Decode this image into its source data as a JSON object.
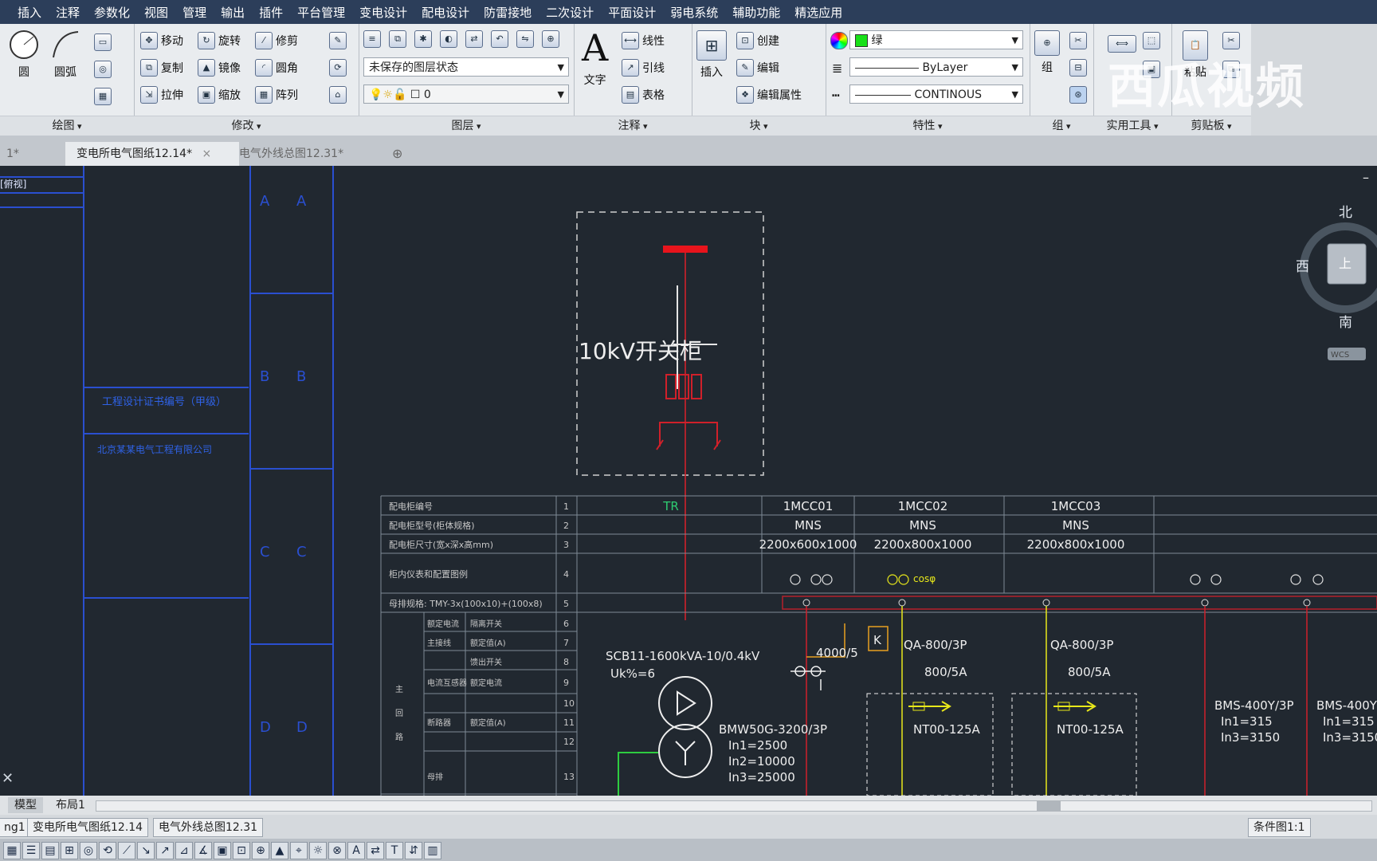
{
  "menu": [
    "插入",
    "注释",
    "参数化",
    "视图",
    "管理",
    "输出",
    "插件",
    "平台管理",
    "变电设计",
    "配电设计",
    "防雷接地",
    "二次设计",
    "平面设计",
    "弱电系统",
    "辅助功能",
    "精选应用"
  ],
  "ribbon": {
    "draw": {
      "title": "绘图",
      "circle": "圆",
      "arc": "圆弧"
    },
    "modify": {
      "title": "修改",
      "move": "移动",
      "rotate": "旋转",
      "trim": "修剪",
      "copy": "复制",
      "mirror": "镜像",
      "fillet": "圆角",
      "stretch": "拉伸",
      "scale": "缩放",
      "array": "阵列"
    },
    "layer": {
      "title": "图层",
      "state": "未保存的图层状态",
      "current": "0"
    },
    "annotation": {
      "title": "注释",
      "text": "文字",
      "linear": "线性",
      "leader": "引线",
      "table": "表格"
    },
    "block": {
      "title": "块",
      "insert": "插入",
      "create": "创建",
      "edit": "编辑",
      "edit_attr": "编辑属性"
    },
    "properties": {
      "title": "特性",
      "color": "绿",
      "lineweight": "ByLayer",
      "linetype": "CONTINOUS"
    },
    "group": {
      "title": "组",
      "label": "组"
    },
    "utilities": {
      "title": "实用工具"
    },
    "clipboard": {
      "title": "剪贴板",
      "paste": "粘贴"
    },
    "watermark": "西瓜视频"
  },
  "tabs": [
    {
      "label": "1*"
    },
    {
      "label": "变电所电气图纸12.14*",
      "close": "×"
    },
    {
      "label": "电气外线总图12.31*"
    }
  ],
  "drawing": {
    "frame_title_1": "工程设计证书编号（甲级）",
    "frame_title_2": "北京某某电气工程有限公司",
    "left_header": "[俯视]",
    "switchgear_label": "10kV开关柜",
    "viewcube": {
      "north": "北",
      "south": "南",
      "west": "西",
      "top": "上",
      "wcs": "WCS"
    },
    "table_row_labels": [
      "配电柜编号",
      "配电柜型号(柜体规格)",
      "配电柜尺寸(宽x深x高mm)",
      "柜内仪表和配置图例",
      "母排规格: TMY-3x(100x10)+(100x8)"
    ],
    "table_row_nums": [
      "1",
      "2",
      "3",
      "4",
      "5",
      "6",
      "7",
      "8",
      "9",
      "10",
      "11",
      "12",
      "13"
    ],
    "sub_labels": [
      "额定电流",
      "主接线",
      "电流互感器",
      "断路器",
      "母排",
      "隔离开关",
      "额定值(A)",
      "馈出开关",
      "额定电流",
      "额定值(A)",
      "主",
      "回",
      "路"
    ],
    "columns": [
      {
        "id": "TR",
        "type": "",
        "size": ""
      },
      {
        "id": "1MCC01",
        "type": "MNS",
        "size": "2200x600x1000"
      },
      {
        "id": "1MCC02",
        "type": "MNS",
        "size": "2200x800x1000"
      },
      {
        "id": "1MCC03",
        "type": "MNS",
        "size": "2200x800x1000"
      }
    ],
    "meter_note": "cosφ",
    "transformer": {
      "model": "SCB11-1600kVA-10/0.4kV",
      "uk": "Uk%=6"
    },
    "breaker_main": {
      "model": "BMW50G-3200/3P",
      "in1": "In1=2500",
      "in2": "In2=10000",
      "in3": "In3=25000"
    },
    "ct_ratio": "4000/5",
    "k_box": "K",
    "qa1": {
      "model": "QA-800/3P",
      "rating": "800/5A",
      "fuse": "NT00-125A"
    },
    "qa2": {
      "model": "QA-800/3P",
      "rating": "800/5A",
      "fuse": "NT00-125A"
    },
    "bms1": {
      "model": "BMS-400Y/3P",
      "in1": "In1=315",
      "in3": "In3=3150"
    },
    "bms2": {
      "model": "BMS-400Y",
      "in1": "In1=315",
      "in3": "In3=3150"
    }
  },
  "layout_tabs": [
    "模型",
    "布局1"
  ],
  "status_tabs": [
    "ng1",
    "变电所电气图纸12.14",
    "电气外线总图12.31"
  ],
  "status_right": "条件图1:1"
}
